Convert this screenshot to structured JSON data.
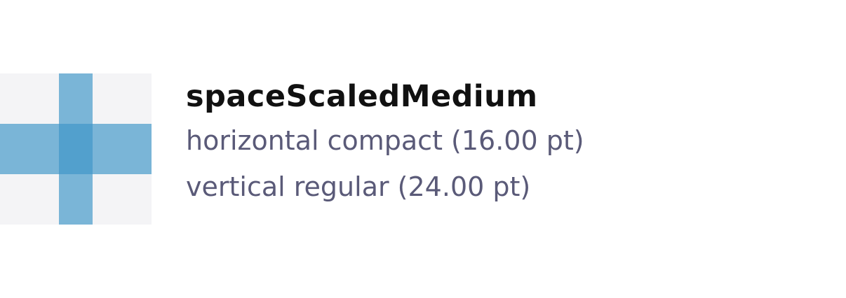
{
  "token": {
    "name": "spaceScaledMedium",
    "horizontal": "horizontal compact (16.00 pt)",
    "vertical": "vertical regular (24.00 pt)"
  },
  "swatch": {
    "background_color": "#f4f4f6",
    "bar_color": "#4096c8"
  }
}
